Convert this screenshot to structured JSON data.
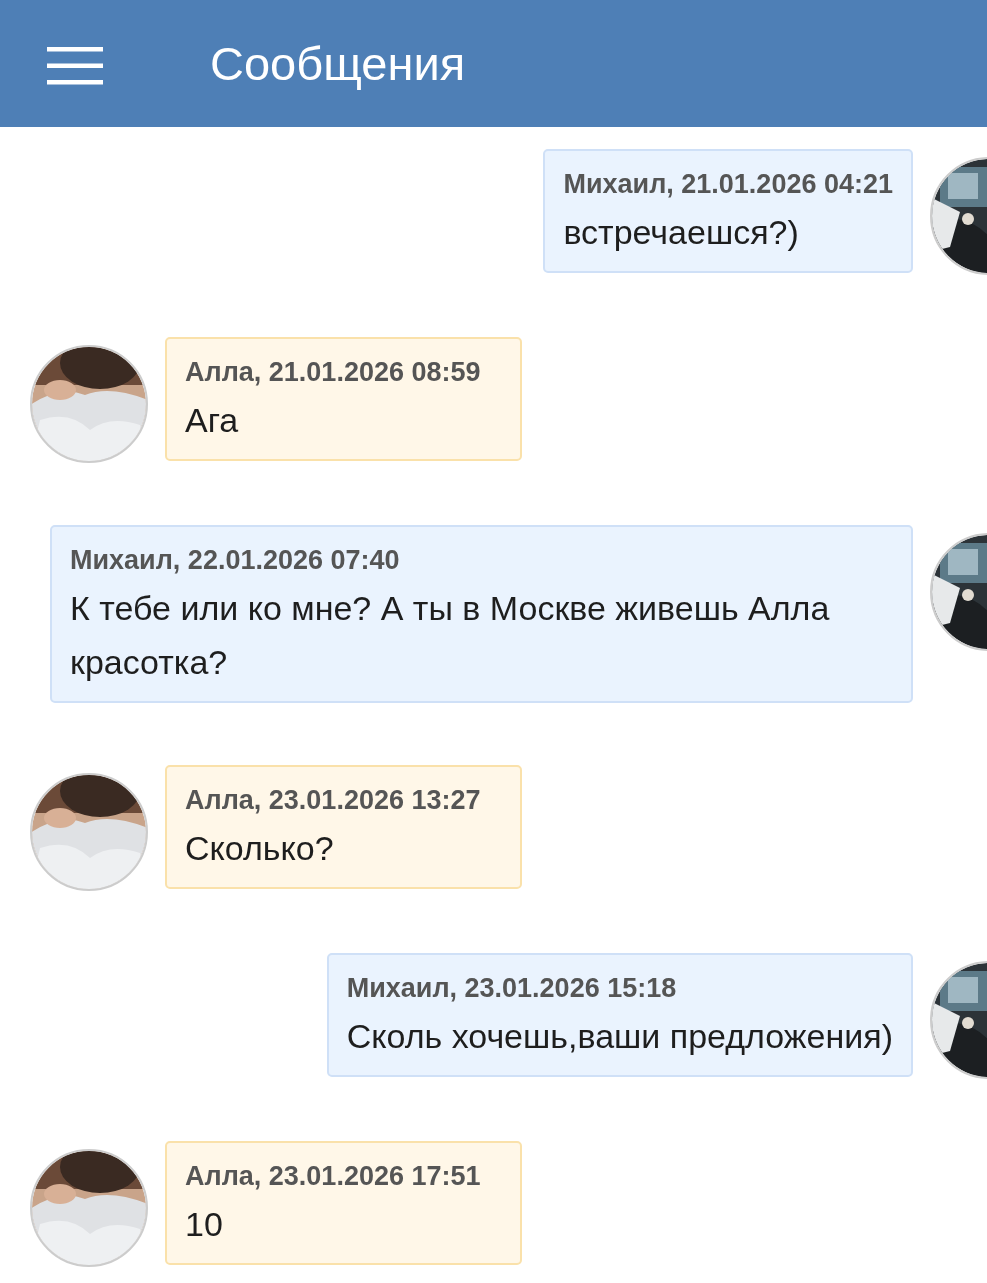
{
  "header": {
    "title": "Сообщения"
  },
  "messages": [
    {
      "kind": "outgoing",
      "meta": "Михаил, 21.01.2026 04:21",
      "text": "встречаешся?)"
    },
    {
      "kind": "incoming",
      "meta": "Алла, 21.01.2026 08:59",
      "text": "Ага"
    },
    {
      "kind": "outgoing",
      "meta": "Михаил, 22.01.2026 07:40",
      "text": "К тебе или ко мне? А ты в Москве живешь Алла красотка?"
    },
    {
      "kind": "incoming",
      "meta": "Алла, 23.01.2026 13:27",
      "text": "Сколько?"
    },
    {
      "kind": "outgoing",
      "meta": "Михаил, 23.01.2026 15:18",
      "text": "Сколь хочешь,ваши предложения)"
    },
    {
      "kind": "incoming",
      "meta": "Алла, 23.01.2026 17:51",
      "text": "10"
    }
  ]
}
